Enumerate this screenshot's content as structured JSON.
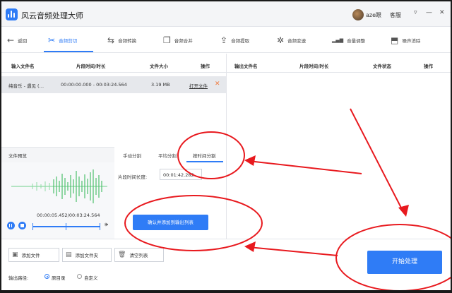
{
  "app": {
    "title": "风云音频处理大师",
    "username": "aze眼",
    "service": "客服",
    "win_menu": "▿",
    "win_min": "—",
    "win_close": "✕"
  },
  "toolbar": {
    "back": "返回",
    "items": [
      {
        "label": "音频剪切",
        "icon": "scissors-icon",
        "glyph": "✂"
      },
      {
        "label": "音频转换",
        "icon": "convert-icon",
        "glyph": "⇆"
      },
      {
        "label": "音频合并",
        "icon": "merge-icon",
        "glyph": "❐"
      },
      {
        "label": "音频提取",
        "icon": "extract-icon",
        "glyph": "⇪"
      },
      {
        "label": "音频变速",
        "icon": "speed-icon",
        "glyph": "✲"
      },
      {
        "label": "音量调整",
        "icon": "volume-bars-icon",
        "glyph": "▂▄▆"
      },
      {
        "label": "噪声消除",
        "icon": "noise-icon",
        "glyph": "⬒"
      }
    ],
    "active_index": 0
  },
  "input_table": {
    "headers": [
      "输入文件名",
      "片段时间/时长",
      "文件大小",
      "操作"
    ],
    "rows": [
      {
        "name": "纯音乐 - 遇见 (…",
        "time": "00:00:00.000 - 00:03:24.564",
        "size": "3.19 MB",
        "action": "打开文件"
      }
    ]
  },
  "output_table": {
    "headers": [
      "输出文件名",
      "片段时间/时长",
      "文件状态",
      "操作"
    ]
  },
  "preview": {
    "label": "文件预览",
    "timecode": "00:00:05.452/00:03:24.564"
  },
  "split_tabs": [
    "手动分割",
    "平均分割",
    "按时间分割"
  ],
  "split_active": 2,
  "segment": {
    "label": "片段时间长度:",
    "value": "00:01:42.282"
  },
  "confirm_button": "确认并添加到输出列表",
  "bottom": {
    "add_file": "添加文件",
    "add_folder": "添加文件夹",
    "clear_list": "清空列表",
    "output_path_label": "输出路径:",
    "option_original": "原目录",
    "option_custom": "自定义",
    "selected_option": "原目录",
    "start": "开始处理"
  },
  "colors": {
    "accent": "#2f7cf6",
    "annotation": "#e8191e",
    "delete": "#f07b3f"
  }
}
